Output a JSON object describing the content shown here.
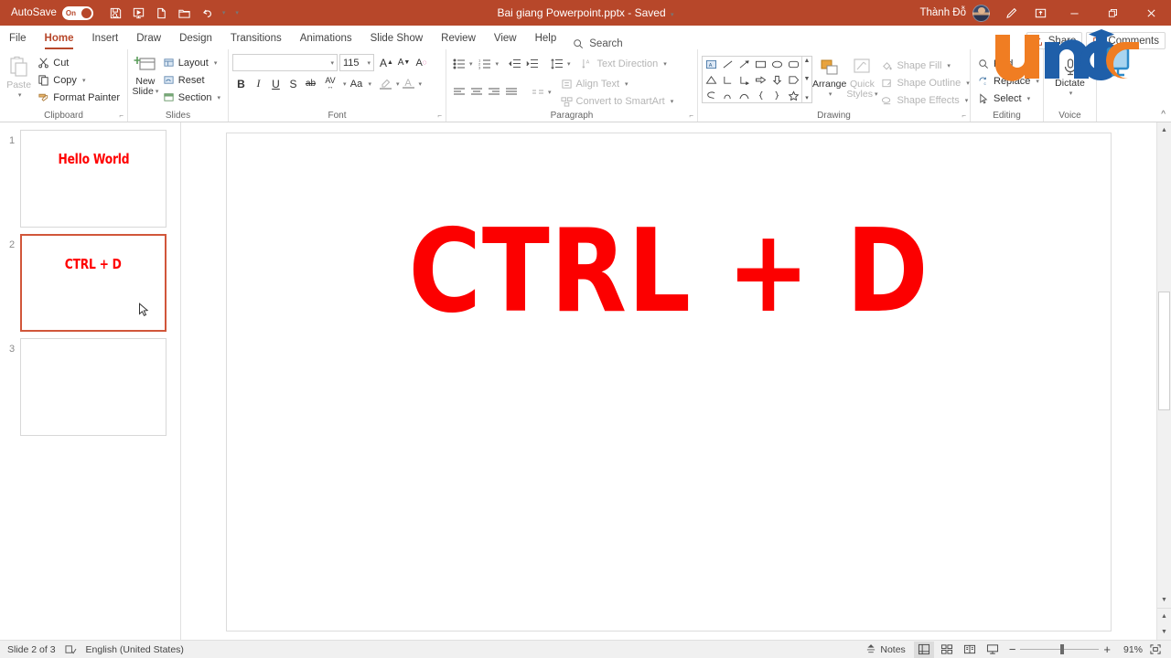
{
  "titlebar": {
    "autosave_label": "AutoSave",
    "autosave_state": "On",
    "doc_title": "Bai giang Powerpoint.pptx",
    "doc_separator": "-",
    "doc_status": "Saved",
    "user_name": "Thành Đỗ",
    "qat": [
      {
        "name": "save-icon",
        "label": "Save"
      },
      {
        "name": "start-from-beginning-icon",
        "label": "Start From Beginning"
      },
      {
        "name": "new-file-icon",
        "label": "New"
      },
      {
        "name": "open-folder-icon",
        "label": "Open"
      },
      {
        "name": "undo-icon",
        "label": "Undo"
      }
    ],
    "window_buttons": {
      "minimize": "—",
      "restore": "❐",
      "close": "✕"
    }
  },
  "tabs": [
    {
      "label": "File",
      "active": false
    },
    {
      "label": "Home",
      "active": true
    },
    {
      "label": "Insert",
      "active": false
    },
    {
      "label": "Draw",
      "active": false
    },
    {
      "label": "Design",
      "active": false
    },
    {
      "label": "Transitions",
      "active": false
    },
    {
      "label": "Animations",
      "active": false
    },
    {
      "label": "Slide Show",
      "active": false
    },
    {
      "label": "Review",
      "active": false
    },
    {
      "label": "View",
      "active": false
    },
    {
      "label": "Help",
      "active": false
    }
  ],
  "search": {
    "label": "Search"
  },
  "share": {
    "label": "Share"
  },
  "comments": {
    "label": "Comments"
  },
  "ribbon": {
    "clipboard": {
      "group_label": "Clipboard",
      "paste_label": "Paste",
      "cut_label": "Cut",
      "copy_label": "Copy",
      "format_painter_label": "Format Painter"
    },
    "slides": {
      "group_label": "Slides",
      "new_slide_label_1": "New",
      "new_slide_label_2": "Slide",
      "layout_label": "Layout",
      "reset_label": "Reset",
      "section_label": "Section"
    },
    "font": {
      "group_label": "Font",
      "font_name_value": "",
      "font_name_placeholder": "",
      "font_size_value": "115",
      "grow_font": "A",
      "shrink_font": "A",
      "clear_formatting": "A",
      "bold": "B",
      "italic": "I",
      "underline": "U",
      "shadow": "S",
      "strikethrough": "ab",
      "char_spacing": "AV",
      "change_case": "Aa",
      "text_highlight": "",
      "font_color": "A"
    },
    "paragraph": {
      "group_label": "Paragraph",
      "text_direction_label": "Text Direction",
      "align_text_label": "Align Text",
      "convert_smartart_label": "Convert to SmartArt"
    },
    "drawing": {
      "group_label": "Drawing",
      "arrange_label": "Arrange",
      "quick_styles_label_1": "Quick",
      "quick_styles_label_2": "Styles",
      "shape_fill_label": "Shape Fill",
      "shape_outline_label": "Shape Outline",
      "shape_effects_label": "Shape Effects"
    },
    "editing": {
      "group_label": "Editing",
      "find_label": "Find",
      "replace_label": "Replace",
      "select_label": "Select"
    },
    "voice": {
      "group_label": "Voice",
      "dictate_label": "Dictate"
    },
    "collapse_label": "^"
  },
  "thumbnails": [
    {
      "number": "1",
      "text": "Hello World",
      "selected": false
    },
    {
      "number": "2",
      "text": "CTRL + D",
      "selected": true
    },
    {
      "number": "3",
      "text": "",
      "selected": false
    }
  ],
  "slide": {
    "text": "CTRL + D",
    "text_color": "#fc0000"
  },
  "status": {
    "slide_counter": "Slide 2 of 3",
    "language": "English (United States)",
    "notes_label": "Notes",
    "zoom_percent": "91%",
    "views": [
      {
        "name": "normal-view-button",
        "active": true
      },
      {
        "name": "slide-sorter-view-button",
        "active": false
      },
      {
        "name": "reading-view-button",
        "active": false
      },
      {
        "name": "slide-show-view-button",
        "active": false
      }
    ],
    "zoom_out": "−",
    "zoom_in": "+"
  },
  "watermark": {
    "text": "unica",
    "orange": "#f07d22",
    "blue": "#1f5fa9",
    "light_blue": "#2e8bc9"
  },
  "theme": {
    "accent": "#b7472a",
    "slide_text_red": "#fc0000",
    "selection_border": "#d1563a"
  }
}
